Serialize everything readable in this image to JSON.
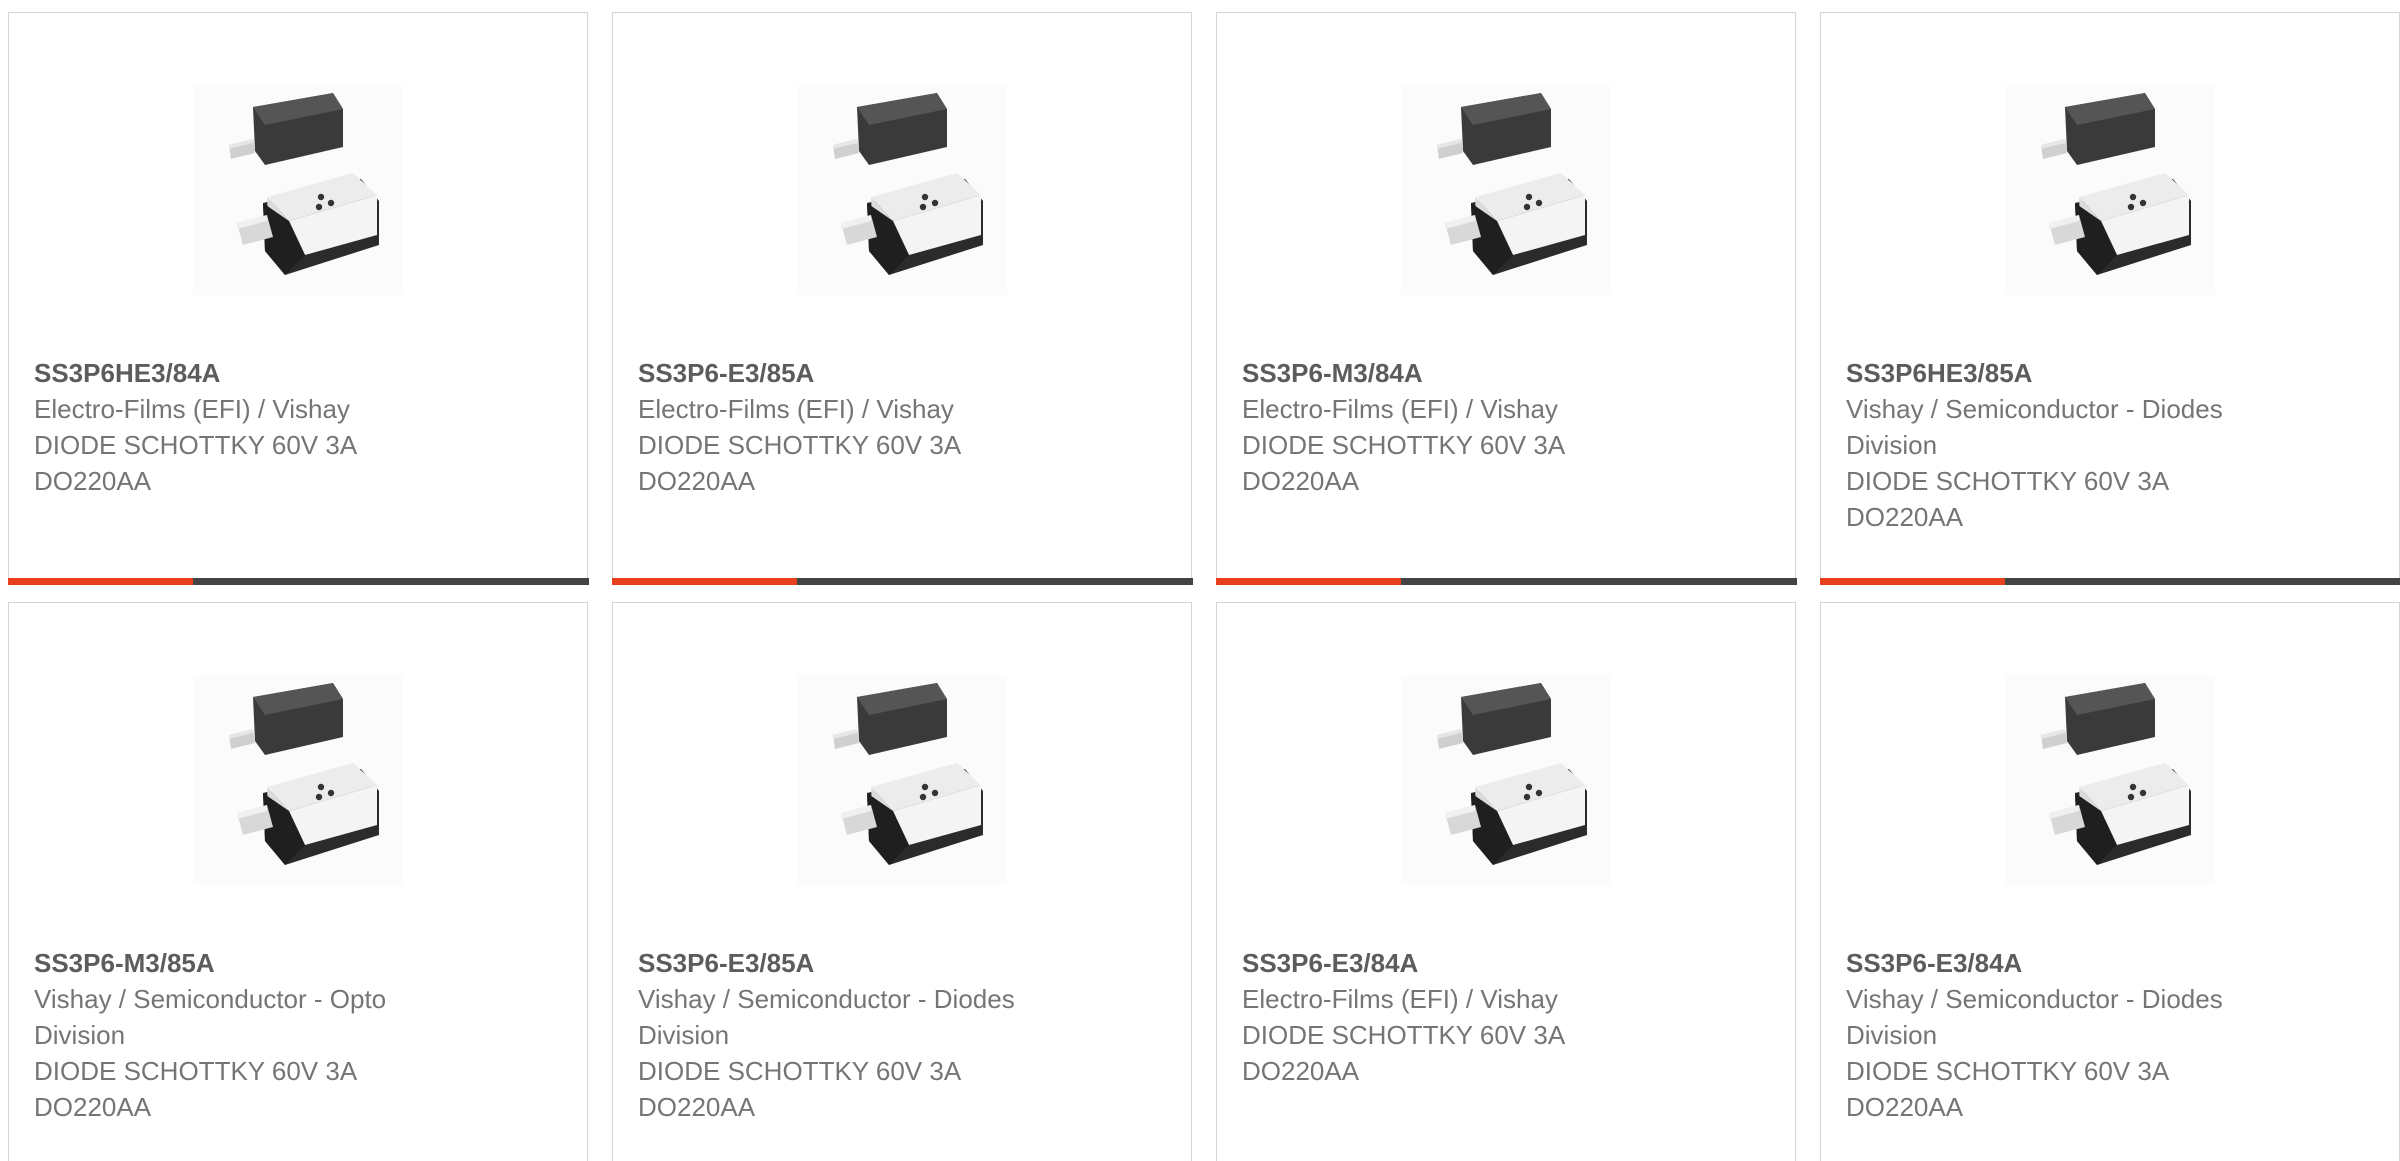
{
  "colors": {
    "accent": "#e8401c",
    "track": "#444444",
    "text": "#757575",
    "part_text": "#5c5c5c",
    "border": "#d4d4d4"
  },
  "products": [
    {
      "part_number": "SS3P6HE3/84A",
      "manufacturer": "Electro-Films (EFI) / Vishay",
      "description": "DIODE SCHOTTKY 60V 3A\nDO220AA",
      "image_icon": "smd-diode-package-icon",
      "progress": 0.32
    },
    {
      "part_number": "SS3P6-E3/85A",
      "manufacturer": "Electro-Films (EFI) / Vishay",
      "description": "DIODE SCHOTTKY 60V 3A\nDO220AA",
      "image_icon": "smd-diode-package-icon",
      "progress": 0.32
    },
    {
      "part_number": "SS3P6-M3/84A",
      "manufacturer": "Electro-Films (EFI) / Vishay",
      "description": "DIODE SCHOTTKY 60V 3A\nDO220AA",
      "image_icon": "smd-diode-package-icon",
      "progress": 0.32
    },
    {
      "part_number": "SS3P6HE3/85A",
      "manufacturer": "Vishay / Semiconductor - Diodes\nDivision",
      "description": "DIODE SCHOTTKY 60V 3A\nDO220AA",
      "image_icon": "smd-diode-package-icon",
      "progress": 0.32
    },
    {
      "part_number": "SS3P6-M3/85A",
      "manufacturer": "Vishay / Semiconductor - Opto\nDivision",
      "description": "DIODE SCHOTTKY 60V 3A\nDO220AA",
      "image_icon": "smd-diode-package-icon"
    },
    {
      "part_number": "SS3P6-E3/85A",
      "manufacturer": "Vishay / Semiconductor - Diodes\nDivision",
      "description": "DIODE SCHOTTKY 60V 3A\nDO220AA",
      "image_icon": "smd-diode-package-icon"
    },
    {
      "part_number": "SS3P6-E3/84A",
      "manufacturer": "Electro-Films (EFI) / Vishay",
      "description": "DIODE SCHOTTKY 60V 3A\nDO220AA",
      "image_icon": "smd-diode-package-icon"
    },
    {
      "part_number": "SS3P6-E3/84A",
      "manufacturer": "Vishay / Semiconductor - Diodes\nDivision",
      "description": "DIODE SCHOTTKY 60V 3A\nDO220AA",
      "image_icon": "smd-diode-package-icon"
    }
  ]
}
